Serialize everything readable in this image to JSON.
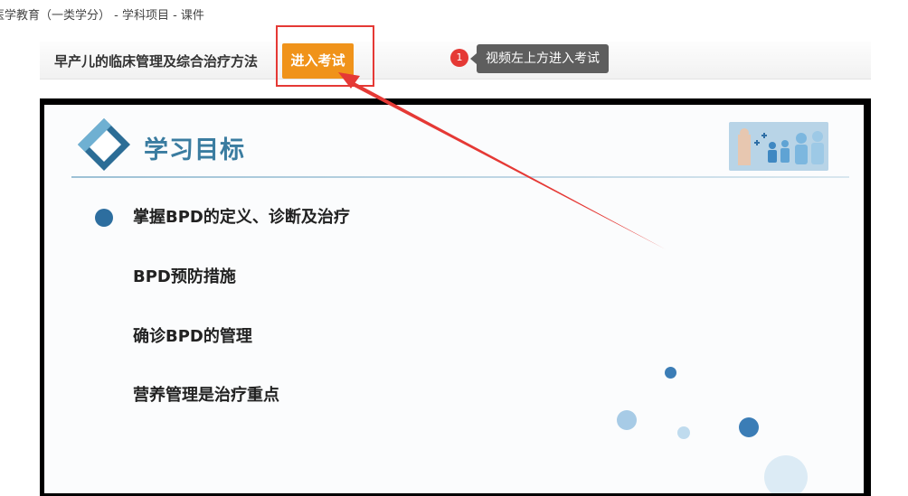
{
  "breadcrumb": {
    "text": "医学教育（一类学分） - 学科项目 - 课件"
  },
  "course": {
    "title": "早产儿的临床管理及综合治疗方法",
    "exam_button_label": "进入考试"
  },
  "tooltip": {
    "badge": "1",
    "text": "视频左上方进入考试"
  },
  "slide": {
    "heading": "学习目标",
    "objectives": [
      "掌握BPD的定义、诊断及治疗",
      "BPD预防措施",
      "确诊BPD的管理",
      "营养管理是治疗重点"
    ]
  },
  "colors": {
    "accent_orange": "#f0931a",
    "highlight_red": "#e53935",
    "slide_blue": "#3a7ca0",
    "tooltip_gray": "#5e5e5e"
  },
  "icons": {
    "annotation": "red-arrow-icon",
    "logo": "diamond-logo-icon",
    "image": "medical-image-icon"
  }
}
